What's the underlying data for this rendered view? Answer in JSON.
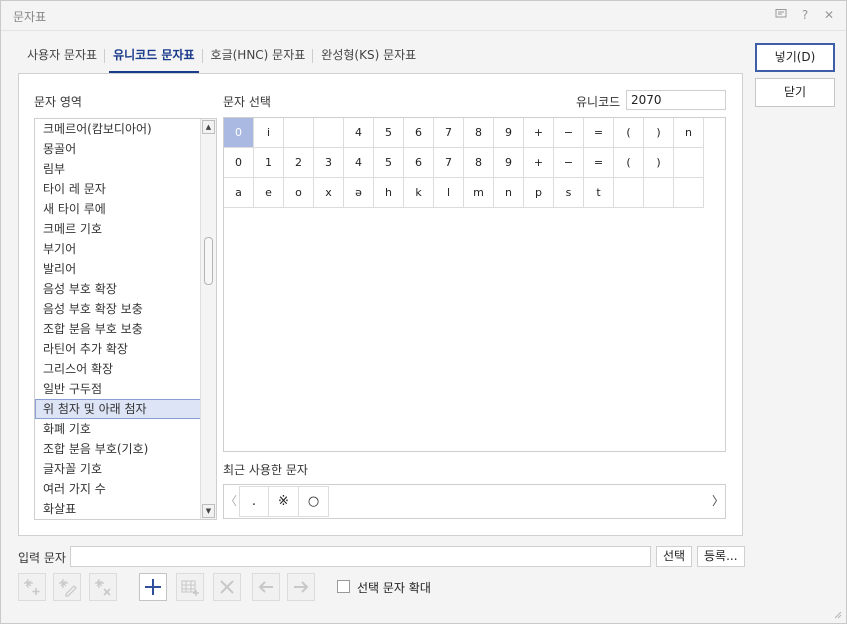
{
  "window": {
    "title": "문자표"
  },
  "titlebar": {
    "icons": [
      "chat-icon",
      "help-icon",
      "close-icon"
    ],
    "help_glyph": "?",
    "close_glyph": "✕"
  },
  "tabs": [
    {
      "label": "사용자 문자표"
    },
    {
      "label": "유니코드 문자표",
      "active": true
    },
    {
      "label": "호글(HNC) 문자표"
    },
    {
      "label": "완성형(KS) 문자표"
    }
  ],
  "area": {
    "label": "문자 영역",
    "items": [
      "크메르어(캄보디아어)",
      "몽골어",
      "림부",
      "타이 레 문자",
      "새 타이 루에",
      "크메르 기호",
      "부기어",
      "발리어",
      "음성 부호 확장",
      "음성 부호 확장 보충",
      "조합 분음 부호 보충",
      "라틴어 추가 확장",
      "그리스어 확장",
      "일반 구두점",
      "위 첨자 및 아래 첨자",
      "화폐 기호",
      "조합 분음 부호(기호)",
      "글자꼴 기호",
      "여러 가지 수",
      "화살표"
    ],
    "selected_index": 14,
    "scroll_up": "▲",
    "scroll_down": "▼"
  },
  "selection": {
    "label": "문자 선택",
    "unicode_label": "유니코드",
    "unicode_value": "2070",
    "rows": [
      [
        "0",
        "i",
        "",
        "",
        "4",
        "5",
        "6",
        "7",
        "8",
        "9",
        "+",
        "−",
        "=",
        "(",
        ")",
        "n"
      ],
      [
        "0",
        "1",
        "2",
        "3",
        "4",
        "5",
        "6",
        "7",
        "8",
        "9",
        "+",
        "−",
        "=",
        "(",
        ")",
        ""
      ],
      [
        "a",
        "e",
        "o",
        "x",
        "ə",
        "h",
        "k",
        "l",
        "m",
        "n",
        "p",
        "s",
        "t",
        "",
        "",
        ""
      ]
    ],
    "selected_cell": [
      0,
      0
    ]
  },
  "recent": {
    "label": "최근 사용한 문자",
    "prev": "〈",
    "next": "〉",
    "chars": [
      ".",
      "※",
      "○"
    ]
  },
  "buttons": {
    "insert": "넣기(D)",
    "close": "닫기"
  },
  "input": {
    "label": "입력 문자",
    "value": "",
    "select": "선택",
    "register": "등록..."
  },
  "toolbar": {
    "tools": [
      {
        "icon": "add-user-chars-icon",
        "enabled": false
      },
      {
        "icon": "edit-user-chars-icon",
        "enabled": false
      },
      {
        "icon": "delete-user-chars-icon",
        "enabled": false
      },
      {
        "icon": "plus-icon",
        "enabled": true
      },
      {
        "icon": "insert-grid-icon",
        "enabled": false
      },
      {
        "icon": "delete-x-icon",
        "enabled": false
      },
      {
        "icon": "arrow-left-icon",
        "enabled": false
      },
      {
        "icon": "arrow-right-icon",
        "enabled": false
      }
    ],
    "zoom_checkbox": {
      "label": "선택 문자 확대",
      "checked": false
    }
  },
  "colors": {
    "accent": "#3f5ea8",
    "selected_cell": "#a9b9e2",
    "selected_item": "#dde4f5"
  }
}
